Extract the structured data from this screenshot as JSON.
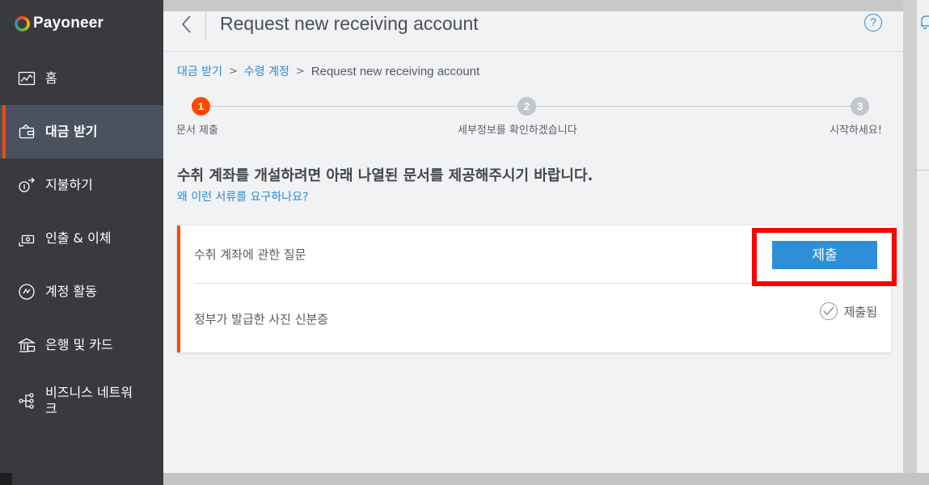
{
  "brand": {
    "name": "Payoneer"
  },
  "sidebar": {
    "items": [
      {
        "label": "홈",
        "icon": "chart-icon"
      },
      {
        "label": "대금 받기",
        "icon": "wallet-icon",
        "active": true
      },
      {
        "label": "지불하기",
        "icon": "payment-icon"
      },
      {
        "label": "인출 & 이체",
        "icon": "transfer-icon"
      },
      {
        "label": "계정 활동",
        "icon": "activity-icon"
      },
      {
        "label": "은행 및 카드",
        "icon": "bank-icon"
      },
      {
        "label": "비즈니스 네트워크",
        "icon": "network-icon"
      }
    ]
  },
  "header": {
    "title": "Request new receiving account",
    "help": "?"
  },
  "breadcrumb": {
    "items": [
      "대금 받기",
      "수령 계정"
    ],
    "separator": ">",
    "current": "Request new receiving account"
  },
  "stepper": {
    "steps": [
      {
        "number": "1",
        "label": "문서 제출",
        "state": "active"
      },
      {
        "number": "2",
        "label": "세부정보를 확인하겠습니다",
        "state": "pending"
      },
      {
        "number": "3",
        "label": "시작하세요!",
        "state": "pending"
      }
    ]
  },
  "intro": {
    "text": "수취 계좌를 개설하려면 아래 나열된 문서를 제공해주시기 바랍니다.",
    "why_link": "왜 이런 서류를 요구하나요?"
  },
  "documents": [
    {
      "name": "수취 계좌에 관한 질문",
      "action_label": "제출"
    },
    {
      "name": "정부가 발급한 사진 신분증",
      "status_label": "제출됨"
    }
  ],
  "colors": {
    "accent": "#ff4800",
    "link": "#2a8ad3",
    "button": "#2e8fd9",
    "highlight": "#ff0000",
    "sidebar": "#393a3e"
  }
}
